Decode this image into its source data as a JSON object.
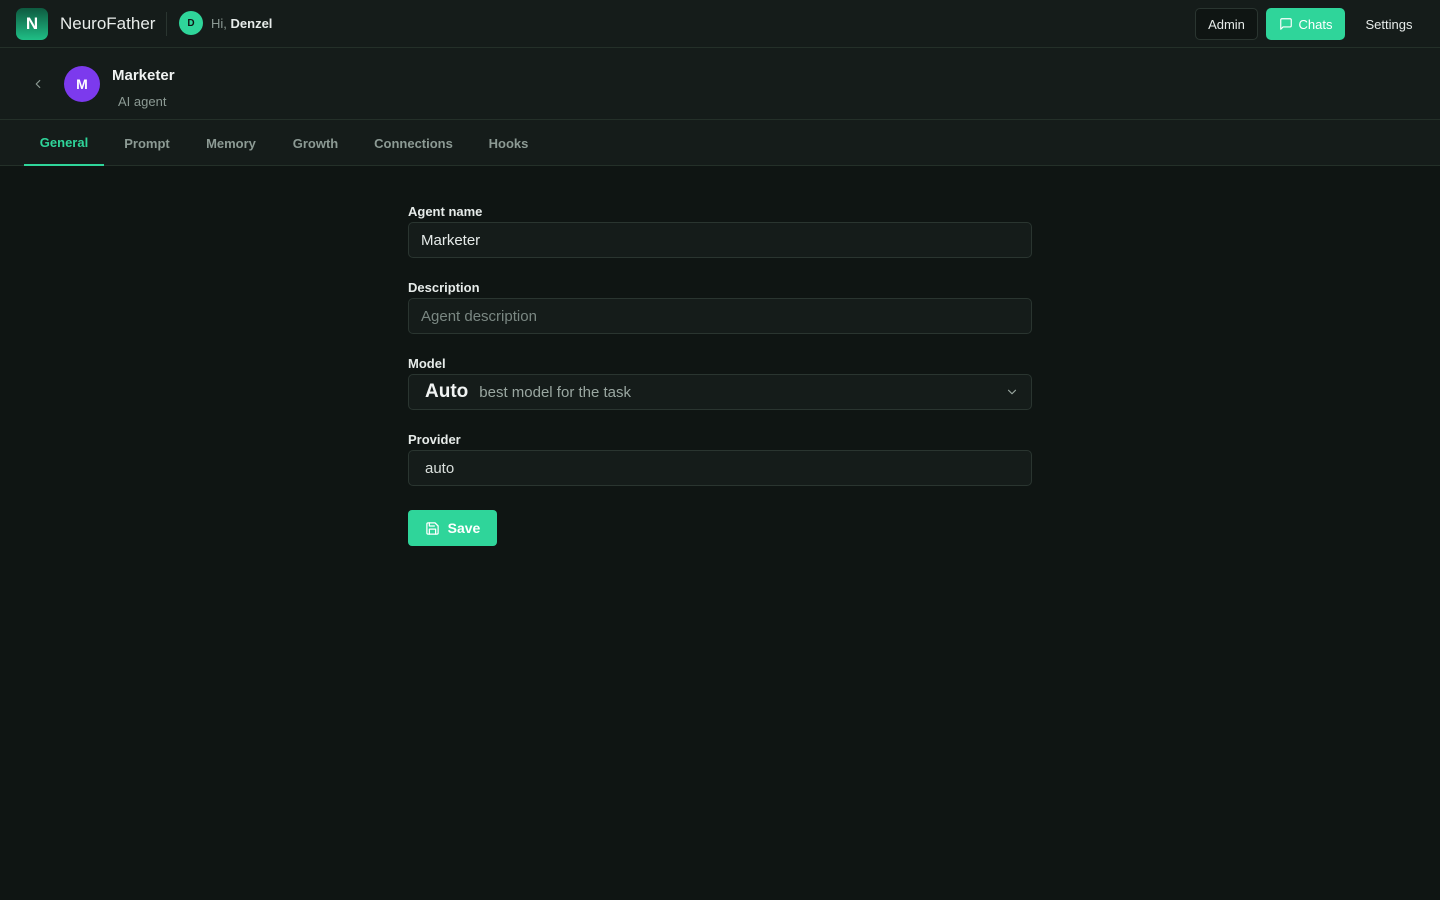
{
  "app": {
    "logo_letter": "N",
    "brand": "NeuroFather",
    "user_initial": "D",
    "greeting_prefix": "Hi,",
    "user_name": "Denzel"
  },
  "header_actions": {
    "admin_label": "Admin",
    "chats_label": "Chats",
    "settings_label": "Settings"
  },
  "agent": {
    "initial": "M",
    "name": "Marketer",
    "type": "AI agent"
  },
  "tabs": [
    {
      "label": "General",
      "active": true
    },
    {
      "label": "Prompt",
      "active": false
    },
    {
      "label": "Memory",
      "active": false
    },
    {
      "label": "Growth",
      "active": false
    },
    {
      "label": "Connections",
      "active": false
    },
    {
      "label": "Hooks",
      "active": false
    }
  ],
  "form": {
    "agent_name_label": "Agent name",
    "agent_name_value": "Marketer",
    "description_label": "Description",
    "description_placeholder": "Agent description",
    "model_label": "Model",
    "model_value": "Auto",
    "model_hint": "best model for the task",
    "provider_label": "Provider",
    "provider_value": "auto",
    "save_label": "Save"
  },
  "icons": {
    "back": "chevron-left-icon",
    "chats": "message-square-icon",
    "model_dropdown": "chevron-down-icon",
    "save": "floppy-disk-icon"
  },
  "colors": {
    "accent": "#2fd59a",
    "agent_avatar": "#7c3aed",
    "background": "#0f1513",
    "surface": "#151c1a"
  }
}
